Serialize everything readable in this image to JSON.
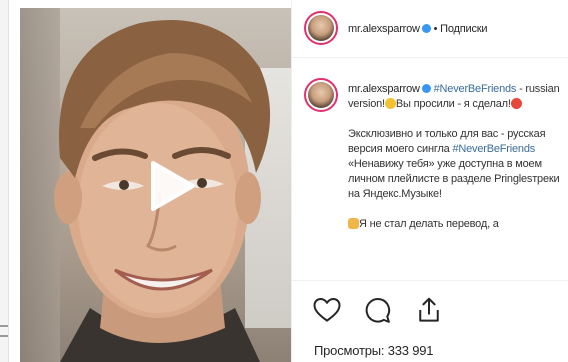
{
  "post": {
    "username": "mr.alexsparrow",
    "separator": "•",
    "follow_label": "Подписки",
    "caption": {
      "username": "mr.alexsparrow",
      "hashtag": "#NeverBeFriends",
      "intro_rest": " - russian version!",
      "intro_end": "Вы просили - я сделал!",
      "para2_start": "Эксклюзивно и только для вас - русская версия моего сингла ",
      "para2_tag": "#NeverBeFriends",
      "para2_rest": " «Ненавижу тебя» уже доступна в моем личном плейлисте в разделе Pringlesтреки на Яндекс.Музыке!",
      "para3": "Я не стал делать перевод, а"
    },
    "views_label": "Просмотры: 333 991"
  },
  "colors": {
    "verified": "#3897f0",
    "hashtag": "#3b6d9c",
    "story_ring": "#e1306c"
  },
  "icons": [
    "play-icon",
    "heart-icon",
    "comment-icon",
    "share-icon",
    "verified-icon"
  ]
}
